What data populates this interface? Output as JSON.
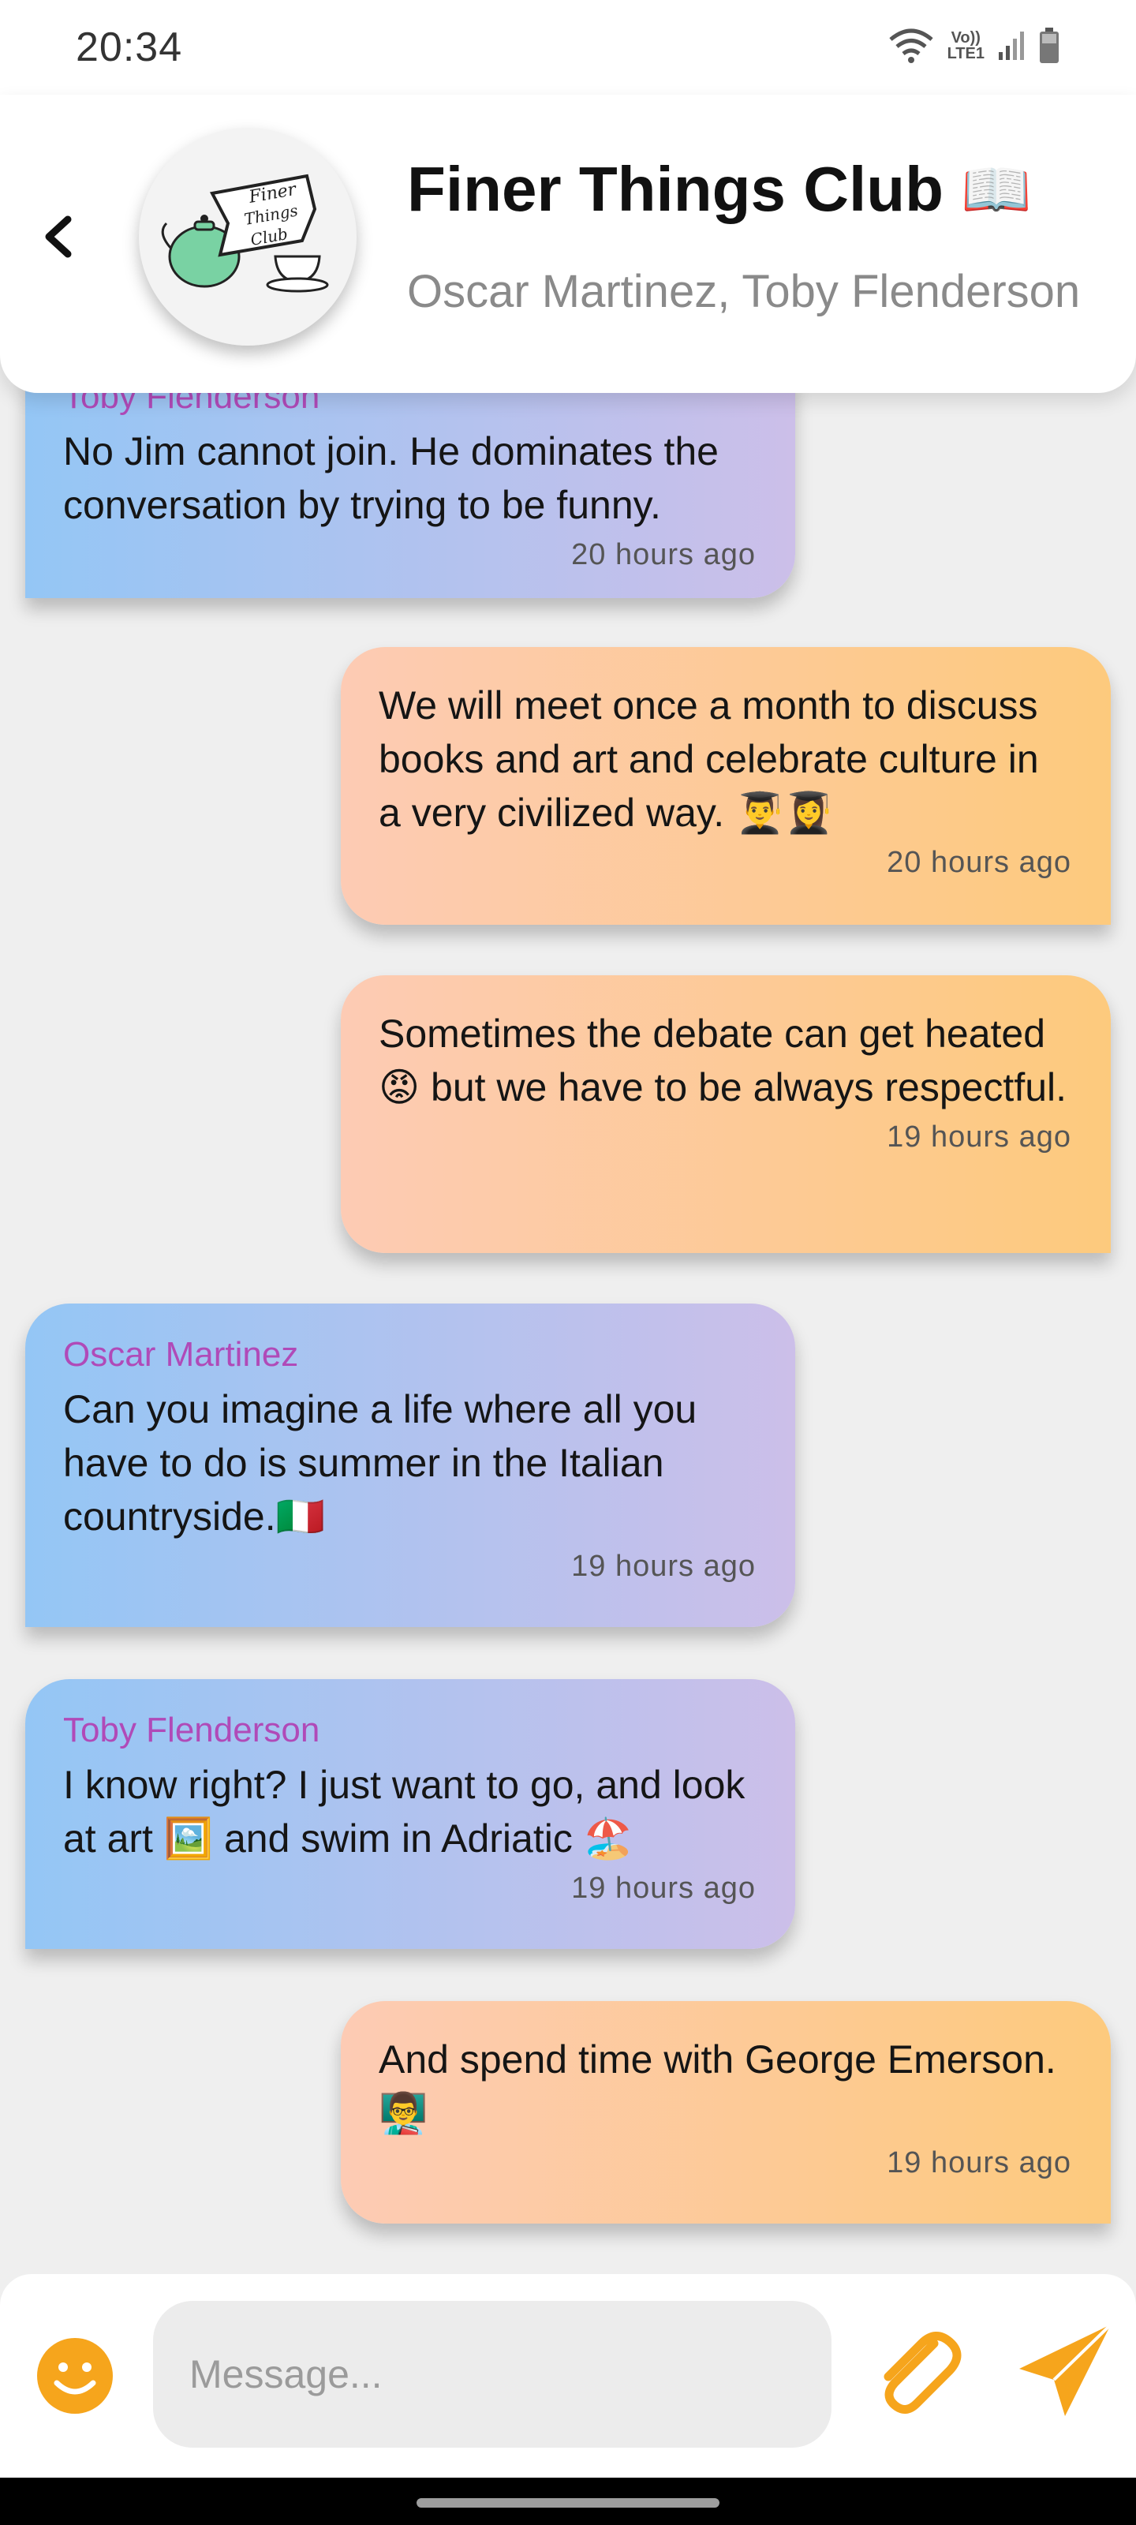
{
  "status_bar": {
    "time": "20:34",
    "network_label_top": "Vo))",
    "network_label_bottom": "LTE1"
  },
  "header": {
    "title": "Finer Things Club",
    "title_emoji": "📖",
    "subtitle": "Oscar Martinez, Toby Flenderson",
    "logo_text": [
      "Finer",
      "Things",
      "Club"
    ]
  },
  "messages": [
    {
      "direction": "incoming",
      "sender": "Toby Flenderson",
      "text": "No Jim cannot join. He dominates the conversation by trying to be funny.",
      "time": "20 hours ago"
    },
    {
      "direction": "outgoing",
      "text": "We will meet once a month to discuss books and art and celebrate culture in a very civilized way. 👨‍🎓👩‍🎓",
      "time": "20 hours ago"
    },
    {
      "direction": "outgoing",
      "text": "Sometimes the debate can get heated 😡 but we have to be always respectful.",
      "time": "19 hours ago"
    },
    {
      "direction": "incoming",
      "sender": "Oscar Martinez",
      "text": "Can you imagine a life where all you have to do is summer in the Italian countryside.🇮🇹",
      "time": "19 hours ago"
    },
    {
      "direction": "incoming",
      "sender": "Toby Flenderson",
      "text": "I know right? I just want to go, and look at art 🖼️ and swim in Adriatic 🏖️",
      "time": "19 hours ago"
    },
    {
      "direction": "outgoing",
      "text": "And spend time with George Emerson. 👨‍🏫",
      "time": "19 hours ago"
    }
  ],
  "composer": {
    "placeholder": "Message..."
  },
  "colors": {
    "accent": "#f6a51c",
    "sender_name": "#b04ab8",
    "incoming_gradient": [
      "#94c6f5",
      "#ccbfe9"
    ],
    "outgoing_gradient": [
      "#fdcbb4",
      "#fdca7d"
    ]
  },
  "icons": {
    "back": "chevron-left-icon",
    "emoji": "smiley-icon",
    "attach": "paperclip-icon",
    "send": "send-icon",
    "wifi": "wifi-icon",
    "signal": "signal-icon",
    "battery": "battery-icon"
  }
}
